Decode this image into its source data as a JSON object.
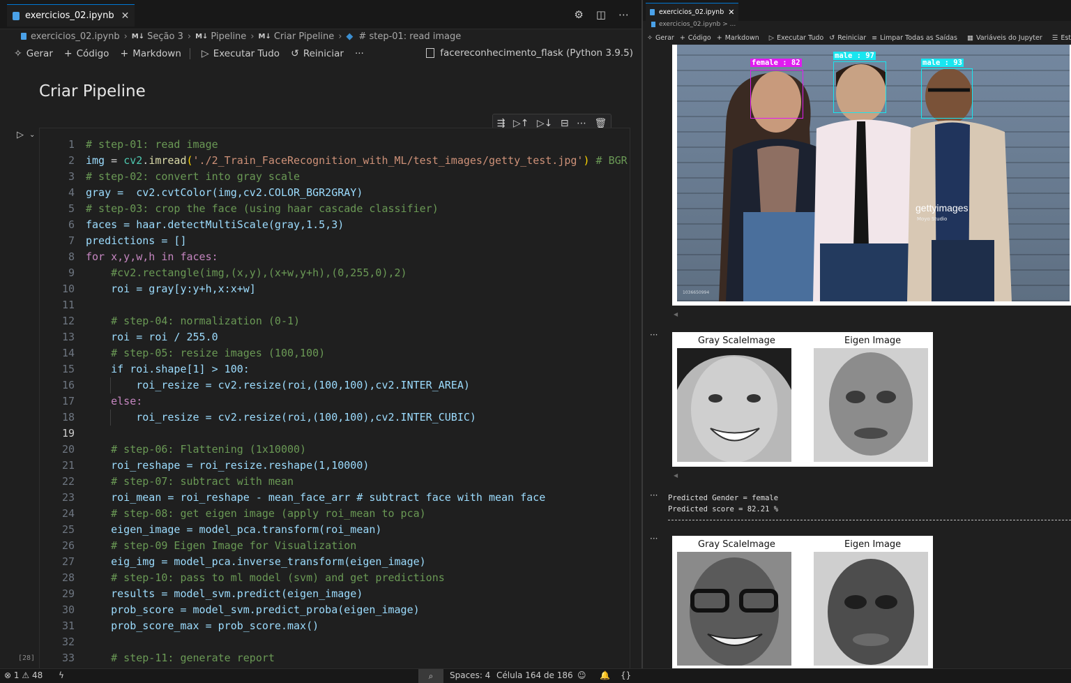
{
  "left_pane": {
    "tab": {
      "title": "exercicios_02.ipynb",
      "close": "✕"
    },
    "breadcrumb": {
      "file": "exercicios_02.ipynb",
      "md_badge": "M↓",
      "section": "Seção 3",
      "pipeline": "Pipeline",
      "criar": "Criar Pipeline",
      "step": "# step-01: read image"
    },
    "toolbar": {
      "gerar": "Gerar",
      "codigo": "Código",
      "markdown": "Markdown",
      "executar": "Executar Tudo",
      "reiniciar": "Reiniciar",
      "more": "···",
      "kernel": "facereconhecimento_flask (Python 3.9.5)"
    },
    "markdown_cell": "Criar Pipeline",
    "exec_count": "[28]",
    "code_lines": [
      "1",
      "2",
      "3",
      "4",
      "5",
      "6",
      "7",
      "8",
      "9",
      "10",
      "11",
      "12",
      "13",
      "14",
      "15",
      "16",
      "17",
      "18",
      "19",
      "20",
      "21",
      "22",
      "23",
      "24",
      "25",
      "26",
      "27",
      "28",
      "29",
      "30",
      "31",
      "32",
      "33"
    ],
    "code_text": {
      "l1": "# step-01: read image",
      "l2a": "img",
      "l2b": " = ",
      "l2c": "cv2",
      "l2d": ".",
      "l2e": "imread",
      "l2f": "(",
      "l2g": "'./2_Train_FaceRecognition_with_ML/test_images/getty_test.jpg'",
      "l2h": ")",
      "l2i": " # BGR",
      "l3": "# step-02: convert into gray scale",
      "l4": "gray =  cv2.cvtColor(img,cv2.COLOR_BGR2GRAY)",
      "l5": "# step-03: crop the face (using haar cascade classifier)",
      "l6": "faces = haar.detectMultiScale(gray,1.5,3)",
      "l7": "predictions = []",
      "l8": "for x,y,w,h in faces:",
      "l9": "    #cv2.rectangle(img,(x,y),(x+w,y+h),(0,255,0),2)",
      "l10": "    roi = gray[y:y+h,x:x+w]",
      "l12": "    # step-04: normalization (0-1)",
      "l13": "    roi = roi / 255.0",
      "l14": "    # step-05: resize images (100,100)",
      "l15": "    if roi.shape[1] > 100:",
      "l16": "        roi_resize = cv2.resize(roi,(100,100),cv2.INTER_AREA)",
      "l17": "    else:",
      "l18": "        roi_resize = cv2.resize(roi,(100,100),cv2.INTER_CUBIC)",
      "l20": "    # step-06: Flattening (1x10000)",
      "l21": "    roi_reshape = roi_resize.reshape(1,10000)",
      "l22": "    # step-07: subtract with mean",
      "l23": "    roi_mean = roi_reshape - mean_face_arr # subtract face with mean face",
      "l24": "    # step-08: get eigen image (apply roi_mean to pca)",
      "l25": "    eigen_image = model_pca.transform(roi_mean)",
      "l26": "    # step-09 Eigen Image for Visualization",
      "l27": "    eig_img = model_pca.inverse_transform(eigen_image)",
      "l28": "    # step-10: pass to ml model (svm) and get predictions",
      "l29": "    results = model_svm.predict(eigen_image)",
      "l30": "    prob_score = model_svm.predict_proba(eigen_image)",
      "l31": "    prob_score_max = prob_score.max()",
      "l33": "    # step-11: generate report"
    }
  },
  "right_pane": {
    "tab": {
      "title": "exercicios_02.ipynb",
      "close": "✕"
    },
    "breadcrumb": "exercicios_02.ipynb > ...",
    "toolbar": {
      "gerar": "Gerar",
      "codigo": "Código",
      "markdown": "Markdown",
      "executar": "Executar Tudo",
      "reiniciar": "Reiniciar",
      "limpar": "Limpar Todas as Saídas",
      "variaveis": "Variáveis do Jupyter",
      "estrutura": "Estrutu"
    },
    "photo": {
      "labels": [
        "female : 82",
        "male : 97",
        "male : 93"
      ],
      "watermark": "gettyimages",
      "watermark_sub": "Moyo Studio",
      "photo_id": "1036650994"
    },
    "panel1": {
      "left_title": "Gray ScaleImage",
      "right_title": "Eigen Image"
    },
    "prediction": {
      "line1": "Predicted Gender = female",
      "line2": "Predicted score = 82.21 %"
    },
    "panel2": {
      "left_title": "Gray ScaleImage",
      "right_title": "Eigen Image"
    },
    "out_marker": "···"
  },
  "statusbar": {
    "errors": "1",
    "warnings": "48",
    "spaces": "Spaces: 4",
    "cell": "Célula 164 de 186"
  },
  "colors": {
    "accent": "#0078d4",
    "female_box": "#e01cf0",
    "male_box": "#18e6f0",
    "comment": "#6a9955",
    "string": "#ce9178",
    "module": "#4ec9b0"
  }
}
